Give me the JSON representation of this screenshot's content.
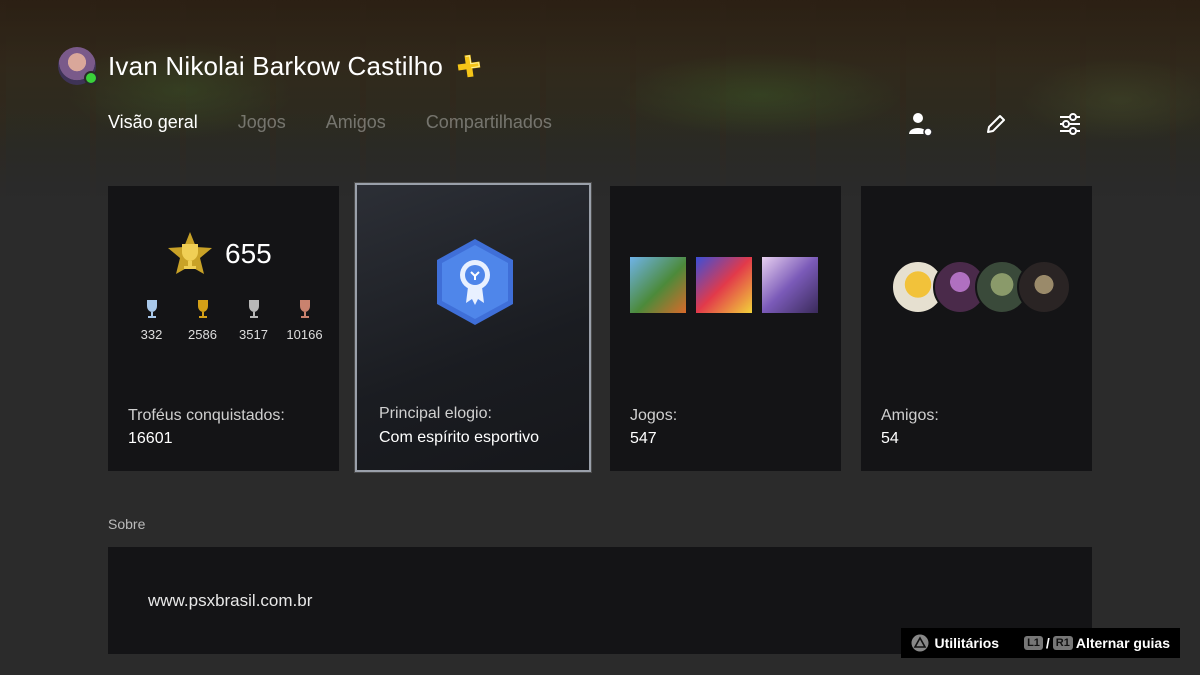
{
  "profile": {
    "username": "Ivan Nikolai Barkow Castilho",
    "online": true,
    "plus_icon": "playstation-plus-icon",
    "avatar_icon": "user-avatar"
  },
  "tabs": [
    {
      "label": "Visão geral",
      "active": true
    },
    {
      "label": "Jogos",
      "active": false
    },
    {
      "label": "Amigos",
      "active": false
    },
    {
      "label": "Compartilhados",
      "active": false
    }
  ],
  "toolbar": {
    "add_friend_icon": "add-friend-icon",
    "edit_icon": "edit-pencil-icon",
    "settings_icon": "sliders-icon"
  },
  "cards": {
    "trophies": {
      "level": "655",
      "platinum": "332",
      "gold": "2586",
      "silver": "3517",
      "bronze": "10166",
      "label": "Troféus conquistados:",
      "value": "16601"
    },
    "accolade": {
      "label": "Principal elogio:",
      "value": "Com espírito esportivo"
    },
    "games": {
      "label": "Jogos:",
      "value": "547"
    },
    "friends": {
      "label": "Amigos:",
      "value": "54"
    }
  },
  "about": {
    "title": "Sobre",
    "text": "www.psxbrasil.com.br"
  },
  "hints": {
    "options_label": "Utilitários",
    "l1": "L1",
    "slash": "/",
    "r1": "R1",
    "switch_label": "Alternar guias"
  },
  "colors": {
    "background": "#2b2b2b",
    "card": "#141416",
    "online": "#3ad13a",
    "plus": "#f5c518",
    "gold": "#d4a017"
  }
}
